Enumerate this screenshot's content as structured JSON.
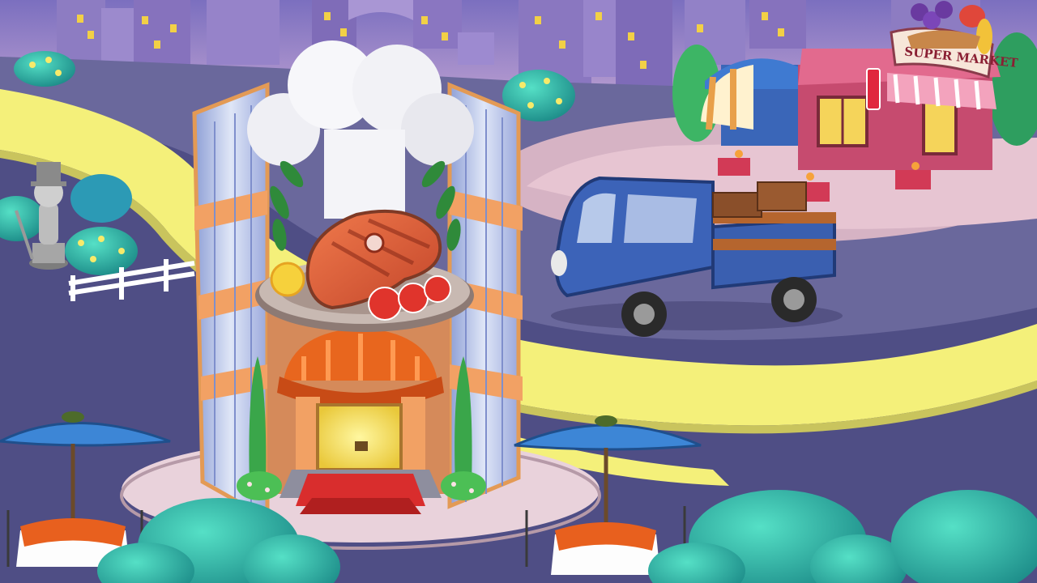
{
  "scene": {
    "type": "city-map",
    "colors": {
      "sky": "#8e7fc4",
      "ground": "#5d5c92",
      "road_yellow": "#f4f07a",
      "building_window": "#f2d046",
      "restaurant_awning": "#e8661e",
      "truck_blue": "#3c63b8",
      "market_pink": "#d9577a",
      "bush_teal": "#2fb6a6",
      "umbrella_blue": "#3d86d6"
    }
  },
  "buildings": {
    "seafood_restaurant": {
      "icon": "steak-plate-icon",
      "state": "unlocked"
    },
    "supermarket": {
      "sign": "SUPER MARKET",
      "icon": "fruit-basket-icon",
      "state": "unlocked"
    },
    "locked_statue": {
      "icon": "statue-icon",
      "state": "locked"
    }
  },
  "vehicles": {
    "delivery_truck": {
      "icon": "truck-icon",
      "cargo": "crates"
    }
  }
}
